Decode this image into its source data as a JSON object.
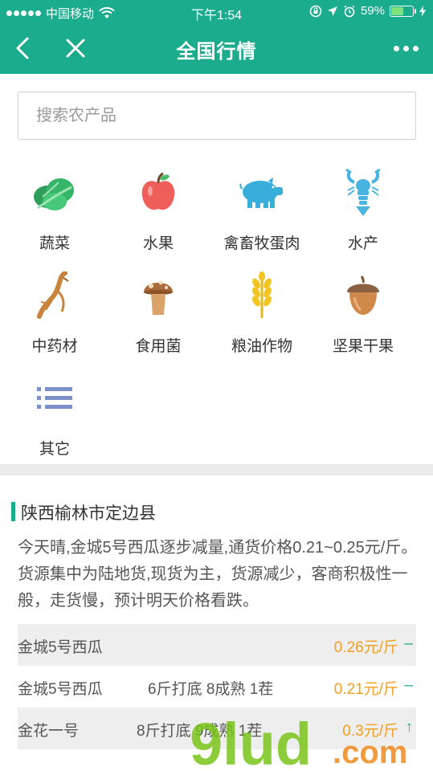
{
  "status_bar": {
    "carrier": "中国移动",
    "time": "下午1:54",
    "battery": "59%",
    "battery_level": 0.59
  },
  "nav": {
    "title": "全国行情"
  },
  "search": {
    "placeholder": "搜索农产品"
  },
  "categories": [
    {
      "label": "蔬菜",
      "icon": "vegetable-icon"
    },
    {
      "label": "水果",
      "icon": "apple-icon"
    },
    {
      "label": "禽畜牧蛋肉",
      "icon": "pig-icon"
    },
    {
      "label": "水产",
      "icon": "lobster-icon"
    },
    {
      "label": "中药材",
      "icon": "ginseng-icon"
    },
    {
      "label": "食用菌",
      "icon": "mushroom-icon"
    },
    {
      "label": "粮油作物",
      "icon": "wheat-icon"
    },
    {
      "label": "坚果干果",
      "icon": "acorn-icon"
    },
    {
      "label": "其它",
      "icon": "list-icon"
    }
  ],
  "market": {
    "location": "陕西榆林市定边县",
    "description": "今天晴,金城5号西瓜逐步减量,通货价格0.21~0.25元/斤。货源集中为陆地货,现货为主，货源减少，客商积极性一般，走货慢，预计明天价格看跌。",
    "rows": [
      {
        "name": "金城5号西瓜",
        "spec": "",
        "price": "0.26元/斤",
        "trend": "–"
      },
      {
        "name": "金城5号西瓜",
        "spec": "6斤打底 8成熟 1茬",
        "price": "0.21元/斤",
        "trend": "–"
      },
      {
        "name": "金花一号",
        "spec": "8斤打底 9成熟 1茬",
        "price": "0.3元/斤",
        "trend": "↑"
      }
    ]
  },
  "watermark": {
    "text": "9lud.com",
    "colors": {
      "nine": "#79c41a",
      "com": "#f08a1a"
    }
  },
  "colors": {
    "brand": "#1aac8c",
    "price": "#f0a020"
  }
}
